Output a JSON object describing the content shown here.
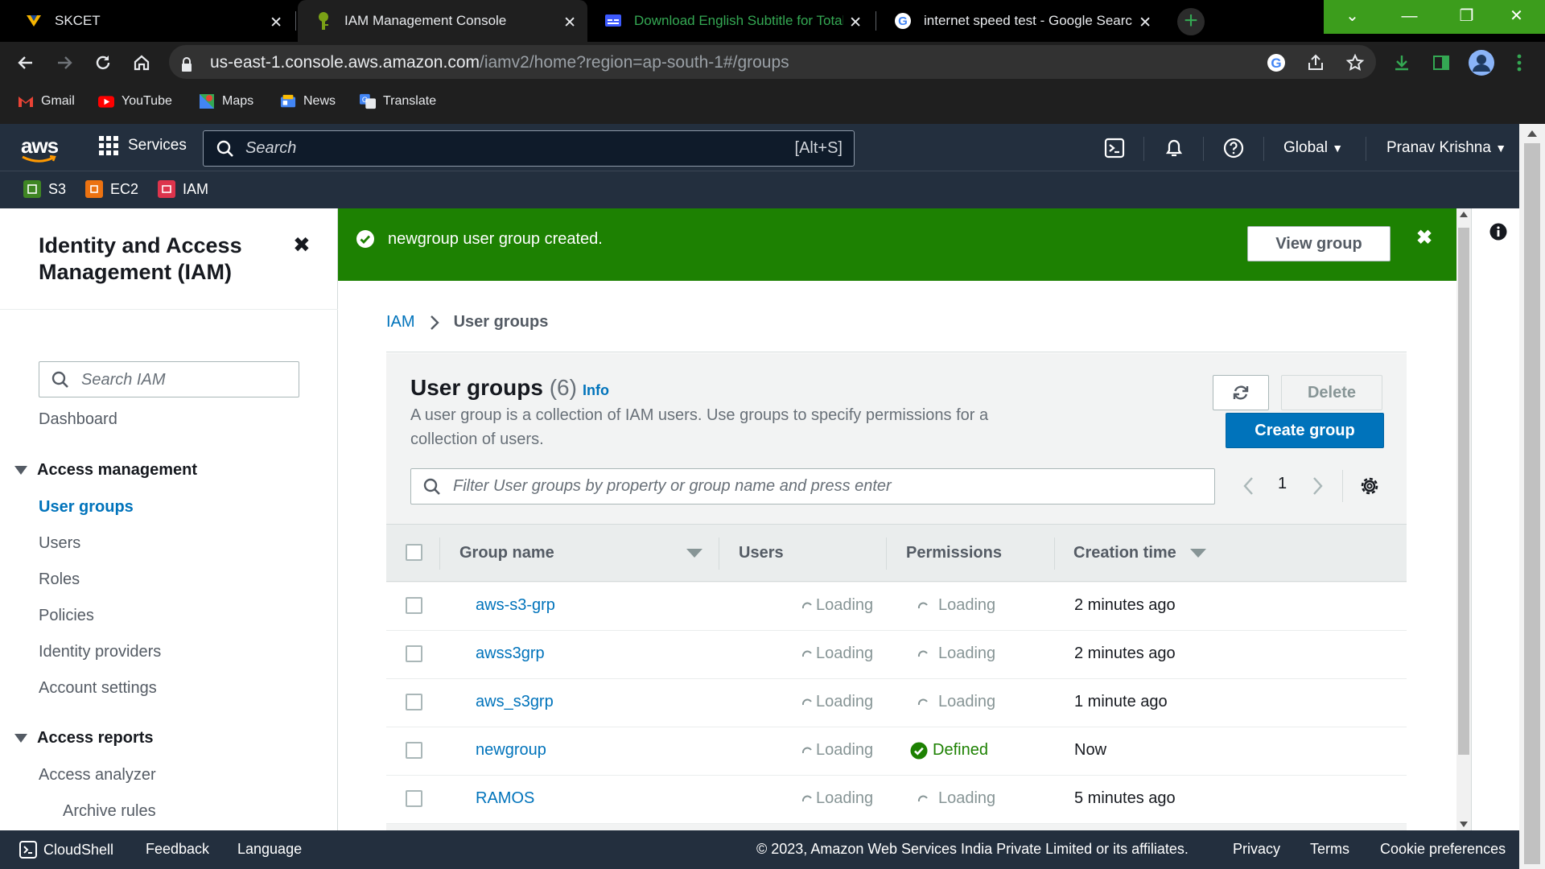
{
  "browser": {
    "tabs": [
      {
        "title": "SKCET",
        "icon": "skcet-favicon"
      },
      {
        "title": "IAM Management Console",
        "icon": "aws-iam-favicon"
      },
      {
        "title": "Download English Subtitle for Total",
        "icon": "subtitle-favicon"
      },
      {
        "title": "internet speed test - Google Search",
        "icon": "google-favicon"
      }
    ],
    "url_host": "us-east-1.console.aws.amazon.com",
    "url_path": "/iamv2/home?region=ap-south-1#/groups",
    "bookmarks": [
      {
        "label": "Gmail",
        "icon": "gmail-icon"
      },
      {
        "label": "YouTube",
        "icon": "youtube-icon"
      },
      {
        "label": "Maps",
        "icon": "maps-icon"
      },
      {
        "label": "News",
        "icon": "news-icon"
      },
      {
        "label": "Translate",
        "icon": "translate-icon"
      }
    ],
    "accent": "#3c9d1c"
  },
  "aws_nav": {
    "logo": "aws",
    "services_label": "Services",
    "search_placeholder": "Search",
    "search_shortcut": "[Alt+S]",
    "region": "Global",
    "user": "Pranav Krishna",
    "favorites": [
      {
        "label": "S3",
        "color": "#3f8624"
      },
      {
        "label": "EC2",
        "color": "#ec7211"
      },
      {
        "label": "IAM",
        "color": "#dd344c"
      }
    ]
  },
  "sidebar": {
    "title": "Identity and Access Management (IAM)",
    "search_placeholder": "Search IAM",
    "dashboard": "Dashboard",
    "access_management": "Access management",
    "items": [
      "User groups",
      "Users",
      "Roles",
      "Policies",
      "Identity providers",
      "Account settings"
    ],
    "access_reports": "Access reports",
    "report_items": [
      "Access analyzer",
      "Archive rules"
    ]
  },
  "flash": {
    "message": "newgroup user group created.",
    "button": "View group"
  },
  "breadcrumb": {
    "root": "IAM",
    "current": "User groups"
  },
  "panel": {
    "title": "User groups",
    "count": "(6)",
    "info": "Info",
    "description": "A user group is a collection of IAM users. Use groups to specify permissions for a collection of users.",
    "delete_label": "Delete",
    "create_label": "Create group",
    "filter_placeholder": "Filter User groups by property or group name and press enter",
    "page": "1",
    "columns": [
      "Group name",
      "Users",
      "Permissions",
      "Creation time"
    ],
    "rows": [
      {
        "name": "aws-s3-grp",
        "users": "Loading",
        "permissions": "Loading",
        "created": "2 minutes ago"
      },
      {
        "name": "awss3grp",
        "users": "Loading",
        "permissions": "Loading",
        "created": "2 minutes ago"
      },
      {
        "name": "aws_s3grp",
        "users": "Loading",
        "permissions": "Loading",
        "created": "1 minute ago"
      },
      {
        "name": "newgroup",
        "users": "Loading",
        "permissions": "Defined",
        "created": "Now"
      },
      {
        "name": "RAMOS",
        "users": "Loading",
        "permissions": "Loading",
        "created": "5 minutes ago"
      }
    ]
  },
  "footer": {
    "cloudshell": "CloudShell",
    "feedback": "Feedback",
    "language": "Language",
    "copyright": "© 2023, Amazon Web Services India Private Limited or its affiliates.",
    "privacy": "Privacy",
    "terms": "Terms",
    "cookies": "Cookie preferences"
  }
}
